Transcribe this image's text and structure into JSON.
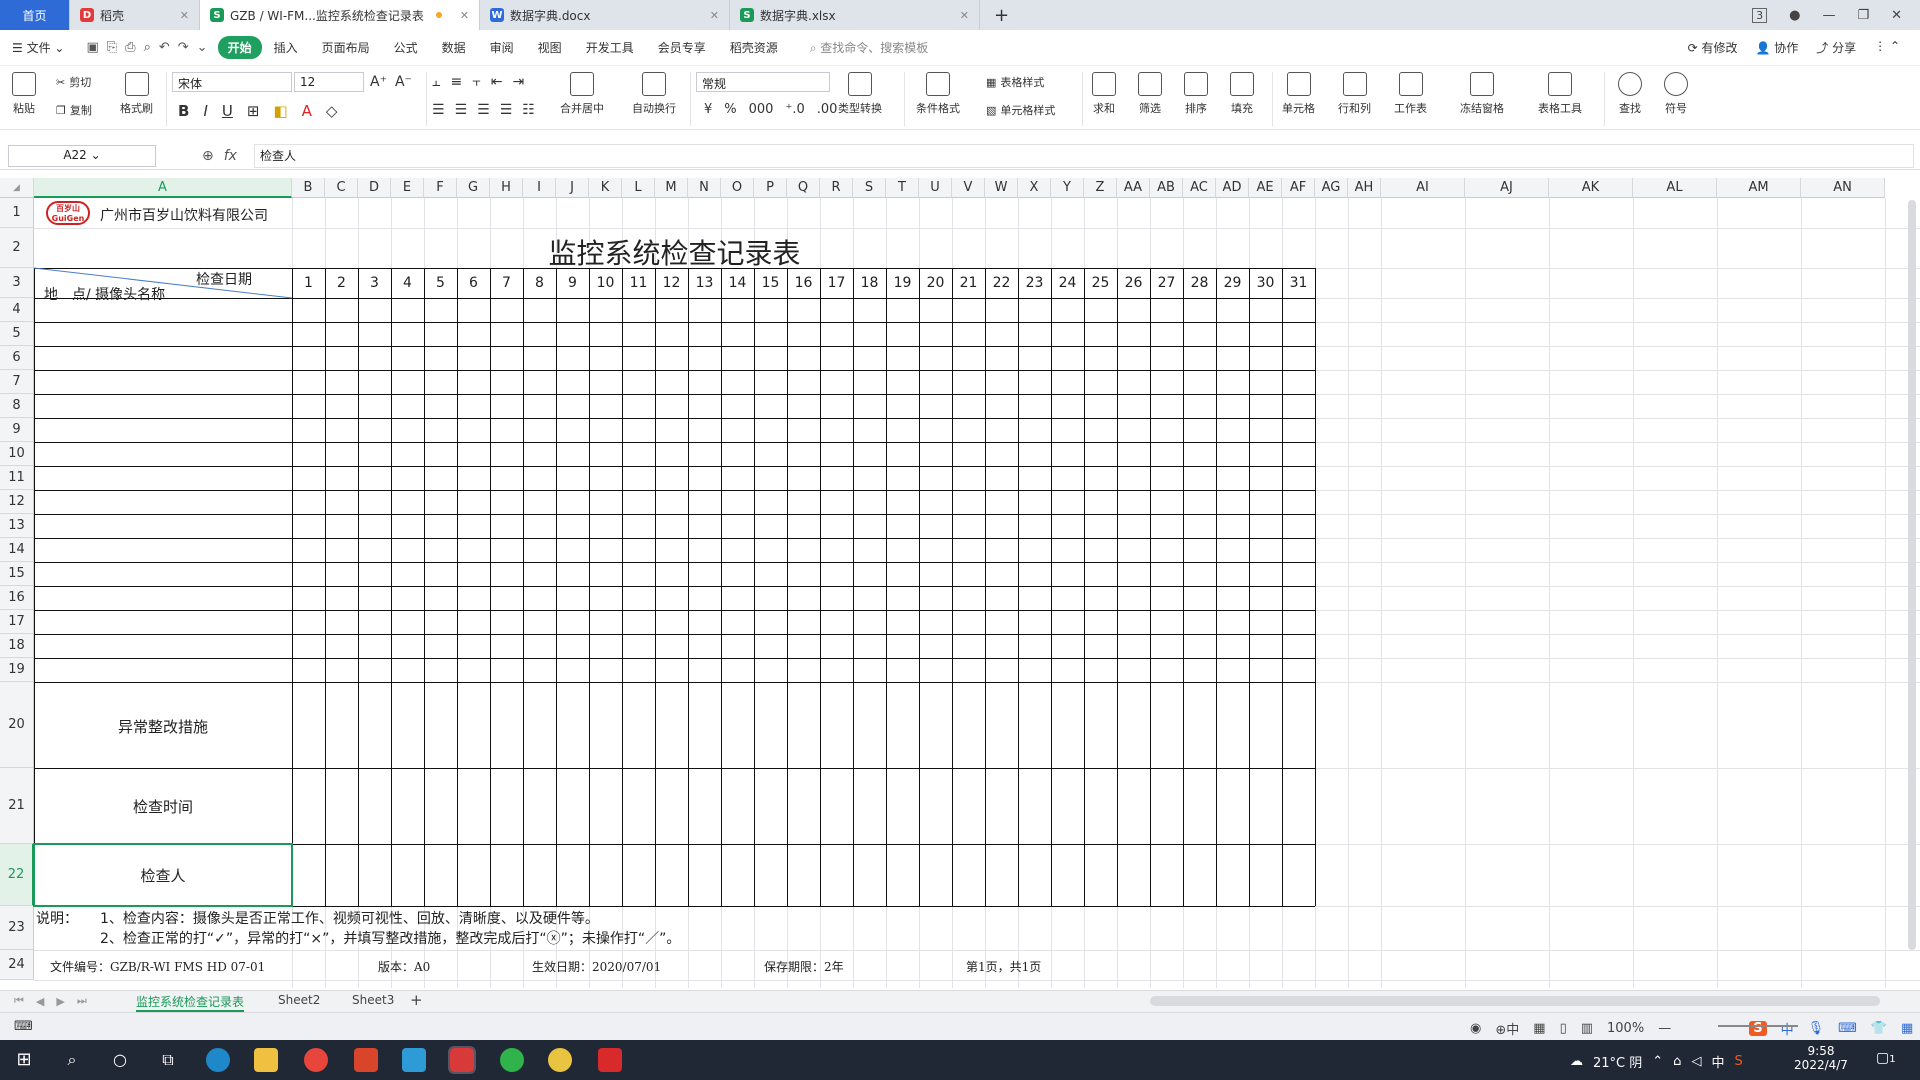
{
  "tabs": [
    {
      "label": "首页",
      "type": "home"
    },
    {
      "label": "稻壳",
      "icon_color": "#e03a3a",
      "icon": "D"
    },
    {
      "label": "GZB / WI-FM...监控系统检查记录表",
      "icon_color": "#1a9a58",
      "icon": "S",
      "active": true
    },
    {
      "label": "数据字典.docx",
      "icon_color": "#2f6bd6",
      "icon": "W"
    },
    {
      "label": "数据字典.xlsx",
      "icon_color": "#1a9a58",
      "icon": "S"
    }
  ],
  "tabbar_right": {
    "badge": "3"
  },
  "menu": {
    "file": "文件",
    "items": [
      "开始",
      "插入",
      "页面布局",
      "公式",
      "数据",
      "审阅",
      "视图",
      "开发工具",
      "会员专享",
      "稻壳资源"
    ],
    "search_placeholder": "查找命令、搜索模板",
    "right": [
      "有修改",
      "协作",
      "分享"
    ]
  },
  "ribbon": {
    "paste": "粘贴",
    "cut": "剪切",
    "copy": "复制",
    "format_painter": "格式刷",
    "font_name": "宋体",
    "font_size": "12",
    "number_format": "常规",
    "merge_center": "合并居中",
    "wrap": "自动换行",
    "currency": "¥",
    "percent": "%",
    "type_convert": "类型转换",
    "cond_format": "条件格式",
    "table_style": "表格样式",
    "cell_style": "单元格样式",
    "sum": "求和",
    "filter": "筛选",
    "sort": "排序",
    "fill": "填充",
    "cell": "单元格",
    "rowcol": "行和列",
    "worksheet": "工作表",
    "freeze": "冻结窗格",
    "table_tools": "表格工具",
    "find": "查找",
    "symbol": "符号"
  },
  "formula_bar": {
    "name_box": "A22",
    "fx": "fx",
    "content": "检查人"
  },
  "columns": [
    "A",
    "B",
    "C",
    "D",
    "E",
    "F",
    "G",
    "H",
    "I",
    "J",
    "K",
    "L",
    "M",
    "N",
    "O",
    "P",
    "Q",
    "R",
    "S",
    "T",
    "U",
    "V",
    "W",
    "X",
    "Y",
    "Z",
    "AA",
    "AB",
    "AC",
    "AD",
    "AE",
    "AF",
    "AG",
    "AH",
    "AI",
    "AJ",
    "AK",
    "AL",
    "AM",
    "AN"
  ],
  "rows": [
    "1",
    "2",
    "3",
    "4",
    "5",
    "6",
    "7",
    "8",
    "9",
    "10",
    "11",
    "12",
    "13",
    "14",
    "15",
    "16",
    "17",
    "18",
    "19",
    "20",
    "21",
    "22",
    "23",
    "24"
  ],
  "sheet": {
    "company": "广州市百岁山饮料有限公司",
    "logo_top": "百岁山",
    "logo_bottom": "GuiGen",
    "title": "监控系统检查记录表",
    "diag_top": "检查日期",
    "diag_bottom": "地　点/ 摄像头名称",
    "days": [
      "1",
      "2",
      "3",
      "4",
      "5",
      "6",
      "7",
      "8",
      "9",
      "10",
      "11",
      "12",
      "13",
      "14",
      "15",
      "16",
      "17",
      "18",
      "19",
      "20",
      "21",
      "22",
      "23",
      "24",
      "25",
      "26",
      "27",
      "28",
      "29",
      "30",
      "31"
    ],
    "row20": "异常整改措施",
    "row21": "检查时间",
    "row22": "检查人",
    "note_label": "说明：",
    "note1": "1、检查内容：摄像头是否正常工作、视频可视性、回放、清晰度、以及硬件等。",
    "note2": "2、检查正常的打“✓”，异常的打“×”，并填写整改措施，整改完成后打“ⓧ”；未操作打“／”。",
    "footer": {
      "doc_no": "文件编号：GZB/R-WI FMS HD 07-01",
      "version": "版本：A0",
      "date": "生效日期：2020/07/01",
      "keep": "保存期限：2年",
      "page": "第1页，共1页"
    }
  },
  "sheet_tabs": [
    "监控系统检查记录表",
    "Sheet2",
    "Sheet3"
  ],
  "status": {
    "zoom": "100%",
    "ime": "中"
  },
  "taskbar": {
    "weather": "21°C 阴",
    "ime": "中",
    "time": "9:58",
    "date": "2022/4/7",
    "notify": "1"
  }
}
